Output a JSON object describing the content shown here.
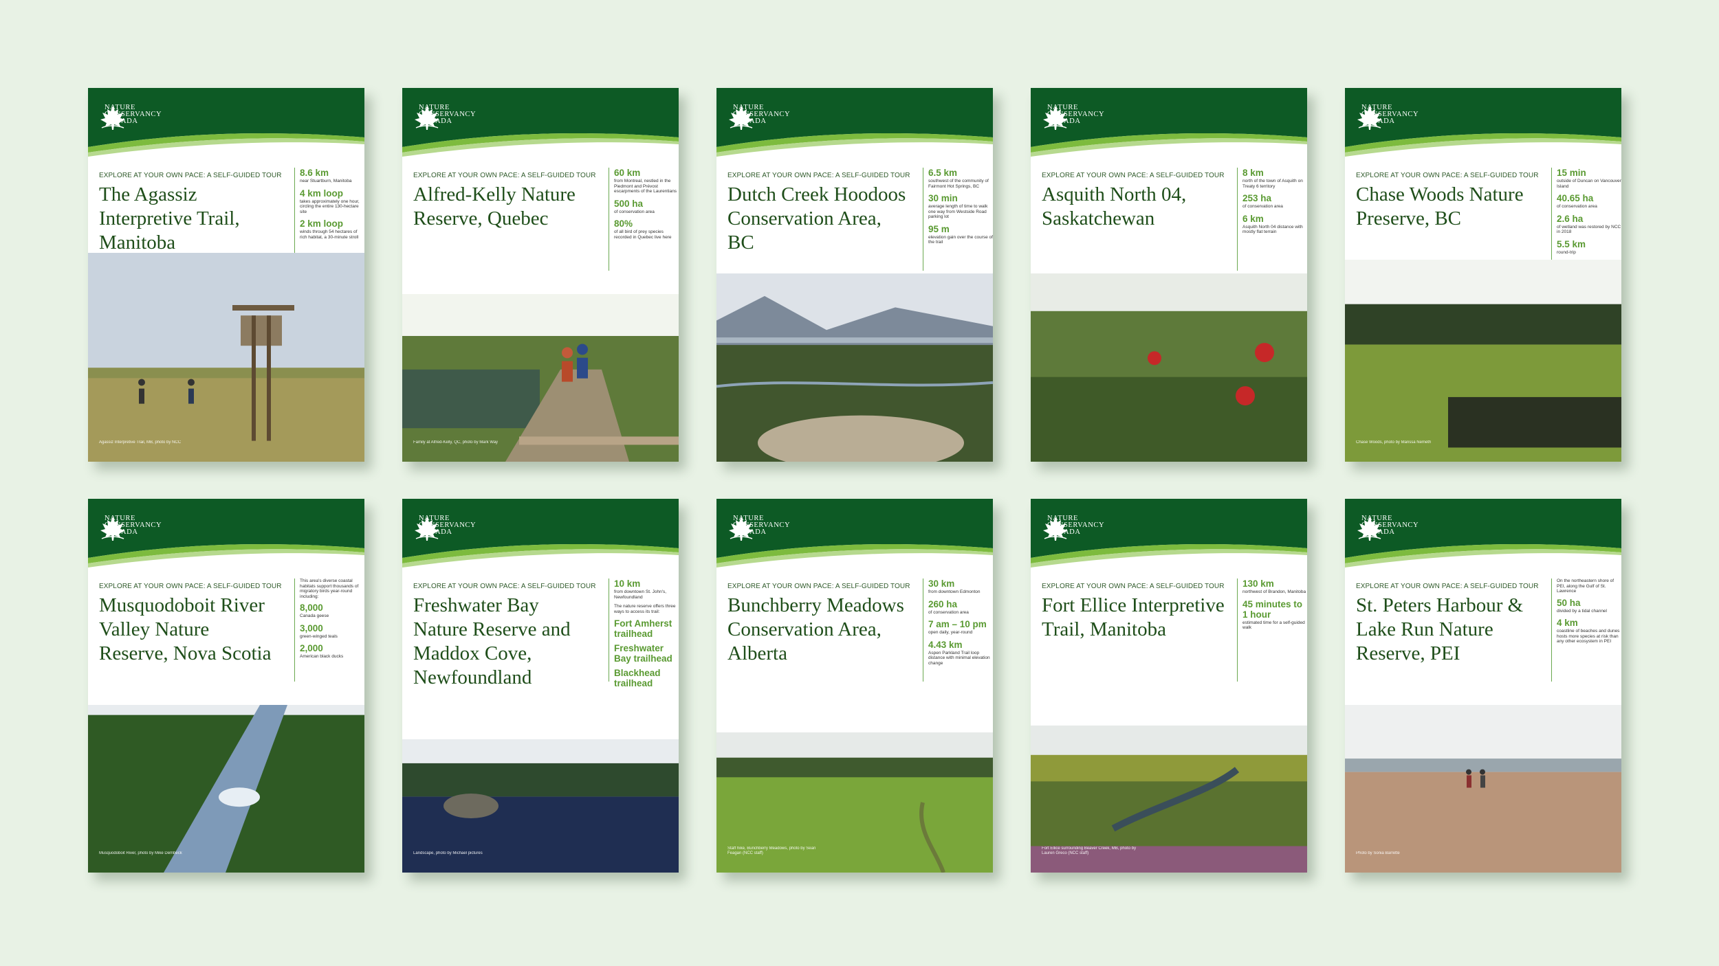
{
  "org_name": "NATURE CONSERVANCY CANADA",
  "kicker": "EXPLORE AT YOUR OWN PACE: A SELF-GUIDED TOUR",
  "colors": {
    "header_green": "#0d5a25",
    "accent_green": "#7dbb3e",
    "title_green": "#1f4e1a",
    "stat_green": "#5a9a32"
  },
  "cards": [
    {
      "title": "The Agassiz Interpretive Trail, Manitoba",
      "stats": [
        {
          "value": "8.6 km",
          "desc": "near Stuartburn, Manitoba"
        },
        {
          "value": "4 km loop",
          "desc": "takes approximately one hour, circling the entire 130-hectare site"
        },
        {
          "value": "2 km loop",
          "desc": "winds through 54 hectares of rich habitat, a 30-minute stroll"
        }
      ],
      "caption": "Agassiz Interpretive Trail, MB, photo by NCC",
      "scene": "prairie"
    },
    {
      "title": "Alfred-Kelly Nature Reserve, Quebec",
      "stats": [
        {
          "value": "60 km",
          "desc": "from Montreal, nestled in the Piedmont and Prévost escarpments of the Laurentians"
        },
        {
          "value": "500 ha",
          "desc": "of conservation area"
        },
        {
          "value": "80%",
          "desc": "of all bird of prey species recorded in Quebec live here"
        }
      ],
      "caption": "Family at Alfred-Kelly, QC, photo by Mark Way",
      "scene": "boardwalk"
    },
    {
      "title": "Dutch Creek Hoodoos Conservation Area, BC",
      "stats": [
        {
          "value": "6.5 km",
          "desc": "southwest of the community of Fairmont Hot Springs, BC"
        },
        {
          "value": "30 min",
          "desc": "average length of time to walk one way from Westside Road parking lot"
        },
        {
          "value": "95 m",
          "desc": "elevation gain over the course of the trail"
        }
      ],
      "caption": "",
      "scene": "valley"
    },
    {
      "title": "Asquith North 04, Saskatchewan",
      "stats": [
        {
          "value": "8 km",
          "desc": "north of the town of Asquith on Treaty 6 territory"
        },
        {
          "value": "253 ha",
          "desc": "of conservation area"
        },
        {
          "value": "6 km",
          "desc": "Asquith North 04 distance with mostly flat terrain"
        }
      ],
      "caption": "",
      "scene": "lilies"
    },
    {
      "title": "Chase Woods Nature Preserve, BC",
      "stats": [
        {
          "value": "15 min",
          "desc": "outside of Duncan on Vancouver Island"
        },
        {
          "value": "40.65 ha",
          "desc": "of conservation area"
        },
        {
          "value": "2.6 ha",
          "desc": "of wetland was restored by NCC in 2018"
        },
        {
          "value": "5.5 km",
          "desc": "round-trip"
        }
      ],
      "caption": "Chase Woods, photo by Marissa Nemeth",
      "scene": "wetland"
    },
    {
      "title": "Musquodoboit River Valley Nature Reserve, Nova Scotia",
      "intro": "This area's diverse coastal habitats support thousands of migratory birds year-round including:",
      "stats": [
        {
          "value": "8,000",
          "desc": "Canada geese"
        },
        {
          "value": "3,000",
          "desc": "green-winged teals"
        },
        {
          "value": "2,000",
          "desc": "American black ducks"
        }
      ],
      "caption": "Musquodoboit River, photo by Mike Dembeck",
      "scene": "river"
    },
    {
      "title": "Freshwater Bay Nature Reserve and Maddox Cove, Newfoundland",
      "intro": "",
      "stats": [
        {
          "value": "10 km",
          "desc": "from downtown St. John's, Newfoundland"
        },
        {
          "value": "",
          "desc": "The nature reserve offers three ways to access its trail:"
        },
        {
          "value": "Fort Amherst trailhead",
          "desc": ""
        },
        {
          "value": "Freshwater Bay trailhead",
          "desc": ""
        },
        {
          "value": "Blackhead trailhead",
          "desc": ""
        }
      ],
      "caption": "Landscape, photo by Michael pictures",
      "scene": "lake"
    },
    {
      "title": "Bunchberry Meadows Conservation Area, Alberta",
      "stats": [
        {
          "value": "30 km",
          "desc": "from downtown Edmonton"
        },
        {
          "value": "260 ha",
          "desc": "of conservation area"
        },
        {
          "value": "7 am – 10 pm",
          "desc": "open daily, year-round"
        },
        {
          "value": "4.43 km",
          "desc": "Aspen Parkland Trail loop distance with minimal elevation change"
        }
      ],
      "caption": "Staff hike, Bunchberry Meadows, photo by Sean Feagan (NCC staff)",
      "scene": "meadow"
    },
    {
      "title": "Fort Ellice Interpretive Trail, Manitoba",
      "stats": [
        {
          "value": "130 km",
          "desc": "northwest of Brandon, Manitoba"
        },
        {
          "value": "45 minutes to 1 hour",
          "desc": "estimated time for a self-guided walk"
        }
      ],
      "caption": "Fort Ellice surrounding Beaver Creek, MB, photo by Lauren Greco (NCC staff)",
      "scene": "autumn"
    },
    {
      "title": "St. Peters Harbour & Lake Run Nature Reserve, PEI",
      "intro": "On the northeastern shore of PEI, along the Gulf of St. Lawrence",
      "stats": [
        {
          "value": "50 ha",
          "desc": "divided by a tidal channel"
        },
        {
          "value": "4 km",
          "desc": "coastline of beaches and dunes hosts more species at risk than any other ecosystem in PEI"
        }
      ],
      "caption": "Photo by Sonia Barrette",
      "scene": "beach"
    }
  ]
}
